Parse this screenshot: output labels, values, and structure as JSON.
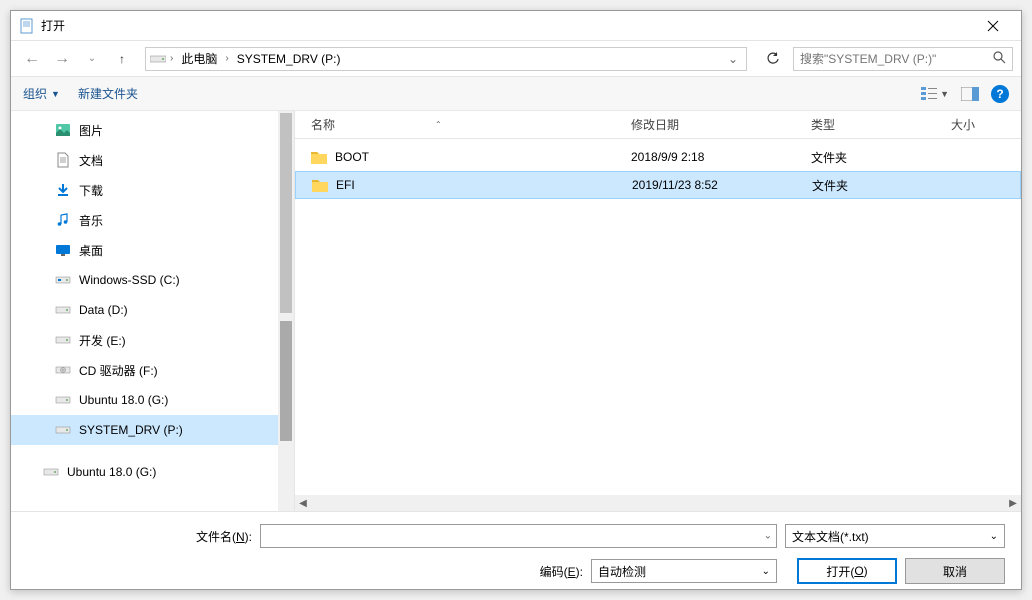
{
  "window": {
    "title": "打开"
  },
  "nav": {
    "breadcrumb": {
      "root": "此电脑",
      "current": "SYSTEM_DRV (P:)"
    },
    "search_placeholder": "搜索\"SYSTEM_DRV (P:)\""
  },
  "toolbar": {
    "organize": "组织",
    "new_folder": "新建文件夹"
  },
  "sidebar": {
    "items": [
      {
        "icon": "pictures",
        "label": "图片"
      },
      {
        "icon": "documents",
        "label": "文档"
      },
      {
        "icon": "downloads",
        "label": "下载"
      },
      {
        "icon": "music",
        "label": "音乐"
      },
      {
        "icon": "desktop",
        "label": "桌面"
      },
      {
        "icon": "drive-ssd",
        "label": "Windows-SSD (C:)"
      },
      {
        "icon": "drive",
        "label": "Data (D:)"
      },
      {
        "icon": "drive",
        "label": "开发 (E:)"
      },
      {
        "icon": "drive-cd",
        "label": "CD 驱动器 (F:)"
      },
      {
        "icon": "drive",
        "label": "Ubuntu 18.0 (G:)"
      },
      {
        "icon": "drive",
        "label": "SYSTEM_DRV (P:)",
        "selected": true
      },
      {
        "icon": "drive",
        "label": "Ubuntu 18.0 (G:)",
        "level": 2
      }
    ]
  },
  "columns": {
    "name": "名称",
    "date": "修改日期",
    "type": "类型",
    "size": "大小"
  },
  "files": [
    {
      "name": "BOOT",
      "date": "2018/9/9 2:18",
      "type": "文件夹"
    },
    {
      "name": "EFI",
      "date": "2019/11/23 8:52",
      "type": "文件夹",
      "selected": true
    }
  ],
  "bottom": {
    "filename_label": "文件名(N):",
    "filter": "文本文档(*.txt)",
    "encoding_label": "编码(E):",
    "encoding": "自动检测",
    "open": "打开(O)",
    "cancel": "取消"
  }
}
